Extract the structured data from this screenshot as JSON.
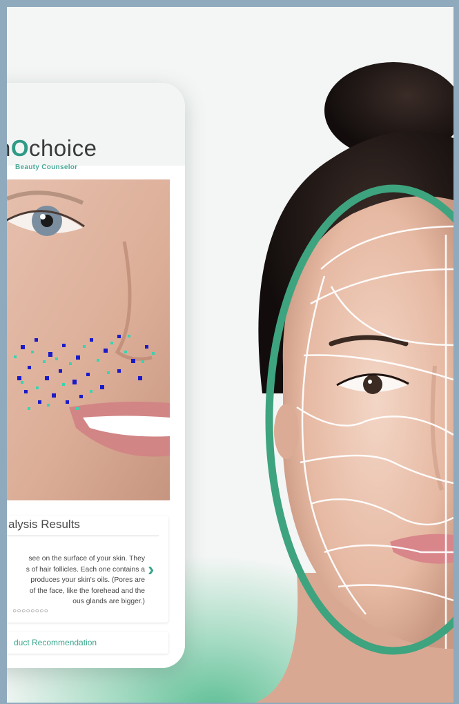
{
  "brand": {
    "prefix": "n",
    "o": "O",
    "suffix": "choice",
    "tagline": "Beauty Counselor"
  },
  "analysis": {
    "title": "alysis Results",
    "lines": [
      "see on the surface of your skin. They",
      "s of hair follicles. Each one contains a",
      "produces your skin's oils. (Pores are",
      "of the face, like the forehead and the",
      "ous glands are bigger.)"
    ],
    "next_icon": "chevron-right-icon",
    "page_dots": "○○○○○○○○"
  },
  "recommendation": {
    "label": "duct Recommendation"
  },
  "colors": {
    "accent": "#3aa58c",
    "oval": "#3ea37f",
    "dot_blue": "#1a1ac8",
    "dot_teal": "#3ad3b0"
  }
}
